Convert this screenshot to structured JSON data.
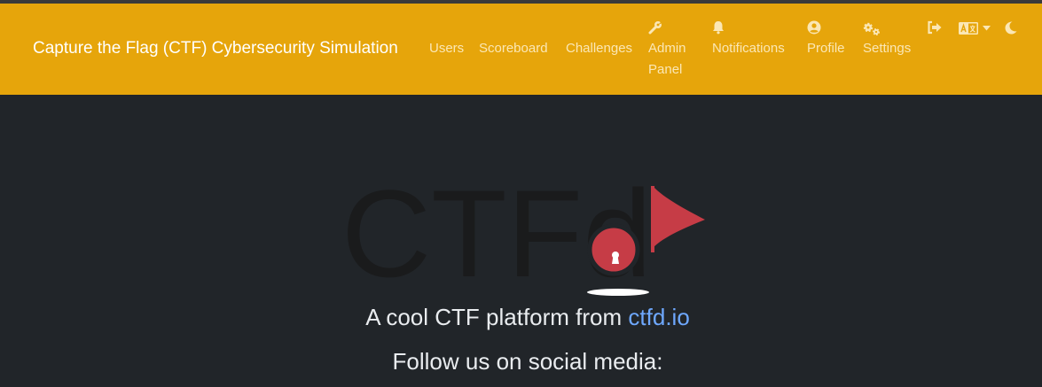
{
  "colors": {
    "navbar_bg": "#e6a50b",
    "page_bg": "#212529",
    "nav_text": "#fbe7b5",
    "link": "#6ea8fe",
    "flag_red": "#c63c46"
  },
  "navbar": {
    "brand": "Capture the Flag (CTF) Cybersecurity Simulation",
    "items": [
      {
        "label": "Users"
      },
      {
        "label": "Scoreboard"
      },
      {
        "label": "Challenges"
      },
      {
        "label_line1": "Admin",
        "label_line2": "Panel",
        "icon": "wrench-icon"
      },
      {
        "label": "Notifications",
        "icon": "bell-icon"
      },
      {
        "label": "Profile",
        "icon": "user-circle-icon"
      },
      {
        "label": "Settings",
        "icon": "gears-icon"
      }
    ],
    "right_icons": [
      "sign-out-icon",
      "language-icon",
      "chevron-down-icon",
      "moon-icon"
    ]
  },
  "logo": {
    "text": "CTFd"
  },
  "tagline": {
    "prefix": "A cool CTF platform from ",
    "link": "ctfd.io"
  },
  "follow": "Follow us on social media:"
}
